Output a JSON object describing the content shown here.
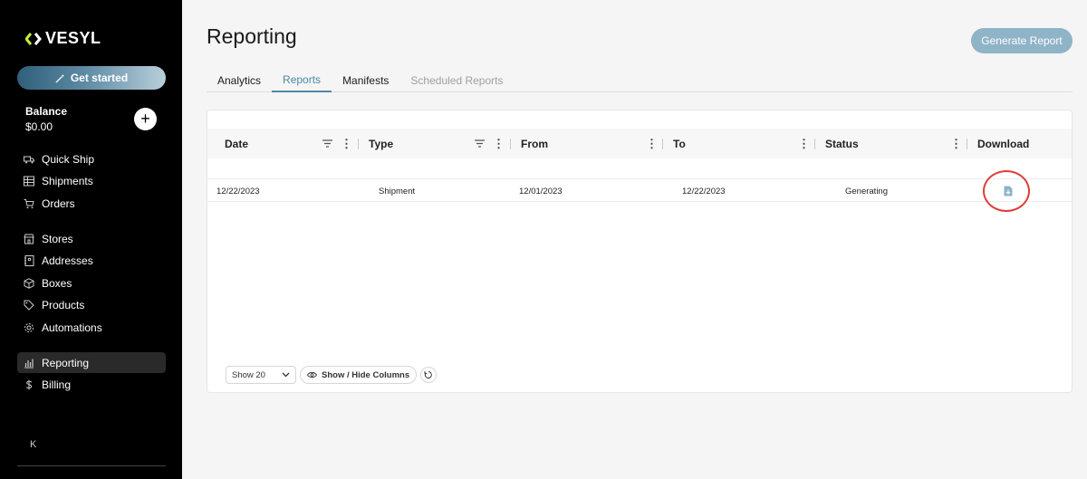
{
  "app": {
    "logo_text": "VESYL"
  },
  "sidebar": {
    "get_started": "Get started",
    "balance_label": "Balance",
    "balance_value": "$0.00",
    "add_symbol": "+",
    "group1": [
      {
        "label": "Quick Ship",
        "icon": "truck-icon"
      },
      {
        "label": "Shipments",
        "icon": "grid-icon"
      },
      {
        "label": "Orders",
        "icon": "cart-icon"
      }
    ],
    "group2": [
      {
        "label": "Stores",
        "icon": "store-icon"
      },
      {
        "label": "Addresses",
        "icon": "address-book-icon"
      },
      {
        "label": "Boxes",
        "icon": "box-icon"
      },
      {
        "label": "Products",
        "icon": "tag-icon"
      },
      {
        "label": "Automations",
        "icon": "gear-icon"
      }
    ],
    "group3": [
      {
        "label": "Reporting",
        "icon": "bar-chart-icon",
        "active": true
      },
      {
        "label": "Billing",
        "icon": "dollar-icon"
      }
    ],
    "collapse_symbol": "K"
  },
  "header": {
    "title": "Reporting",
    "generate_button": "Generate Report"
  },
  "tabs": [
    {
      "label": "Analytics",
      "state": "normal"
    },
    {
      "label": "Reports",
      "state": "active"
    },
    {
      "label": "Manifests",
      "state": "normal"
    },
    {
      "label": "Scheduled Reports",
      "state": "disabled"
    }
  ],
  "table": {
    "columns": [
      "Date",
      "Type",
      "From",
      "To",
      "Status",
      "Download"
    ],
    "rows": [
      {
        "date": "12/22/2023",
        "type": "Shipment",
        "from": "12/01/2023",
        "to": "12/22/2023",
        "status": "Generating"
      }
    ],
    "show_select": "Show 20",
    "show_hide_columns": "Show / Hide Columns"
  },
  "colors": {
    "accent": "#4f88a6",
    "generate_button": "#8fb3c7",
    "annotation": "#e03b3b",
    "logo_accent": "#c5ef3a"
  }
}
